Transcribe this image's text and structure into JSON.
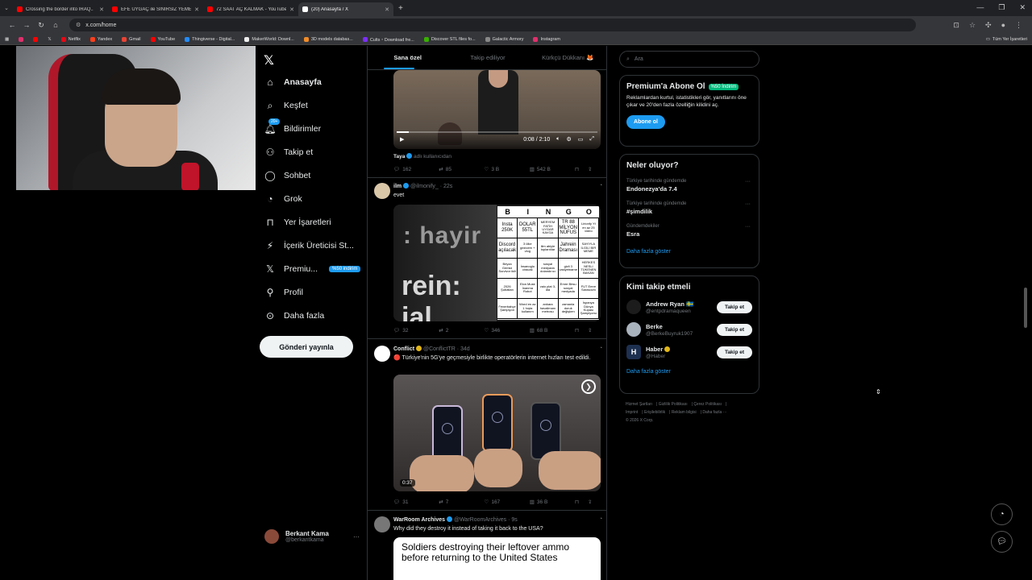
{
  "browser": {
    "tabs": [
      {
        "title": "Crossing the border into IRAQ..",
        "icon": "youtube",
        "active": false
      },
      {
        "title": "EFE UYGAÇ ile SINIRSIZ YEMEK",
        "icon": "youtube",
        "active": false
      },
      {
        "title": "72 SAAT AÇ KALMAK - YouTube",
        "icon": "youtube",
        "active": false
      },
      {
        "title": "(20) Anasayfa / X",
        "icon": "x",
        "active": true
      }
    ],
    "url": "x.com/home",
    "bookmarks": [
      "Netflix",
      "Yandex",
      "Gmail",
      "YouTube",
      "Thingiverse - Digital...",
      "MakerWorld: Downl...",
      "3D models databas...",
      "Cults・Download fre...",
      "Discover STL files fo...",
      "Galactic Armory",
      "Instagram"
    ],
    "all_bookmarks": "Tüm Yer İşaretleri"
  },
  "nav": {
    "items": [
      {
        "label": "Anasayfa",
        "icon": "home-icon",
        "bold": true
      },
      {
        "label": "Keşfet",
        "icon": "search-icon"
      },
      {
        "label": "Bildirimler",
        "icon": "bell-icon",
        "badge": "20+"
      },
      {
        "label": "Takip et",
        "icon": "follow-icon"
      },
      {
        "label": "Sohbet",
        "icon": "chat-icon"
      },
      {
        "label": "Grok",
        "icon": "grok-icon"
      },
      {
        "label": "Yer İşaretleri",
        "icon": "bookmark-icon"
      },
      {
        "label": "İçerik Üreticisi St...",
        "icon": "creator-icon"
      },
      {
        "label": "Premiu...",
        "icon": "x-icon",
        "badge": "%50 indirim"
      },
      {
        "label": "Profil",
        "icon": "profile-icon"
      },
      {
        "label": "Daha fazla",
        "icon": "more-icon"
      }
    ],
    "post_button": "Gönderi yayınla",
    "account": {
      "name": "Berkant Kama",
      "handle": "@berkantkama"
    }
  },
  "timeline": {
    "tabs": [
      "Sana özel",
      "Takip ediliyor",
      "Kürkçü Dükkanı 🦊"
    ],
    "post1": {
      "video_time": "0:08 / 2:10",
      "progress": 0.06,
      "caption_user": "Taya",
      "caption_rest": "adlı kullanıcıdan",
      "replies": "162",
      "reposts": "85",
      "likes": "3 B",
      "views": "542 B"
    },
    "post2": {
      "name": "ilm",
      "handle": "@ilmonify_",
      "time": "22s",
      "text": "evet",
      "img_text1": ": hayir",
      "img_text2": "rein: jal",
      "bingo_head": [
        "B",
        "I",
        "N",
        "G",
        "O"
      ],
      "bingo_cells": [
        "Insta 250K",
        "DOLAR 55TL",
        "MERYEM FATİH UYGAR KAVGA",
        "TR 88 MİLYON NÜFUS",
        "Lirionfy Yt en az 25 video",
        "Discord açılacak",
        "3 ülke gezicem + vlog",
        "ilim abiyle toplantılar",
        "Jahrein Draması",
        "SAYIYLA İLGİLİ BİR MEME",
        "Beyza Gemici Survivor ikili",
        "İnsanoglu ciracak",
        "sosyal medyada dolandırıcı",
        "gizli 3 vasiyetname",
        "HERKES NESLİ TÜKENEN BAKAN",
        "2026 Şubatları",
        "Elon Musk İnanma Robot",
        "vaio plat 3-dia",
        "Emre Birsu sosyal medyada",
        "FUT Emre Sarasovin",
        "Fenerbahçe Şampiyon",
        "Word en az 1 hışta kullanım",
        "ankara havalimanı metrosu",
        "zamanla doruk değişken",
        "İspanya Dünya Kupası Şampiyonu"
      ],
      "replies": "32",
      "reposts": "2",
      "likes": "346",
      "views": "68 B"
    },
    "post3": {
      "name": "Conflict",
      "handle": "@ConflictTR",
      "time": "34d",
      "text": "🔴 Türkiye'nin 5G'ye geçmesiyle birlikte operatörlerin internet hızları test edildi.",
      "duration": "0:37",
      "replies": "31",
      "reposts": "7",
      "likes": "167",
      "views": "36 B"
    },
    "post4": {
      "name": "WarRoom Archives",
      "handle": "@WarRoomArchives",
      "time": "9s",
      "text": "Why did they destroy it instead of taking it back to the USA?",
      "img_text": "Soldiers destroying their leftover ammo before returning to the United States"
    }
  },
  "sidebar": {
    "search_placeholder": "Ara",
    "premium": {
      "title": "Premium'a Abone Ol",
      "discount": "%50 İndirim",
      "body": "Reklamlardan kurtul, istatistikleri gör, yanıtlarını öne çıkar ve 20'den fazla özelliğin kilidini aç.",
      "button": "Abone ol"
    },
    "trends": {
      "title": "Neler oluyor?",
      "items": [
        {
          "context": "Türkiye tarihinde gündemde",
          "name": "Endonezya'da 7.4"
        },
        {
          "context": "Türkiye tarihinde gündemde",
          "name": "#şimdilik"
        },
        {
          "context": "Gündemdekiler",
          "name": "Esra"
        }
      ],
      "show_more": "Daha fazla göster"
    },
    "who_to_follow": {
      "title": "Kimi takip etmeli",
      "items": [
        {
          "name": "Andrew Ryan 🇸🇪",
          "handle": "@entpdramaqueen",
          "button": "Takip et"
        },
        {
          "name": "Berke",
          "handle": "@BerkeBuyruk1907",
          "button": "Takip et"
        },
        {
          "name": "Haber",
          "handle": "@Haber",
          "button": "Takip et"
        }
      ],
      "show_more": "Daha fazla göster"
    },
    "footer": [
      "Hizmet Şartları",
      "Gizlilik Politikası",
      "Çerez Politikası",
      "Imprint",
      "Erişilebilirlik",
      "Reklam bilgisi",
      "Daha fazla ···",
      "© 2026 X Corp."
    ]
  },
  "colors": {
    "accent": "#1d9bf0",
    "bg": "#000000",
    "muted": "#71767b"
  }
}
